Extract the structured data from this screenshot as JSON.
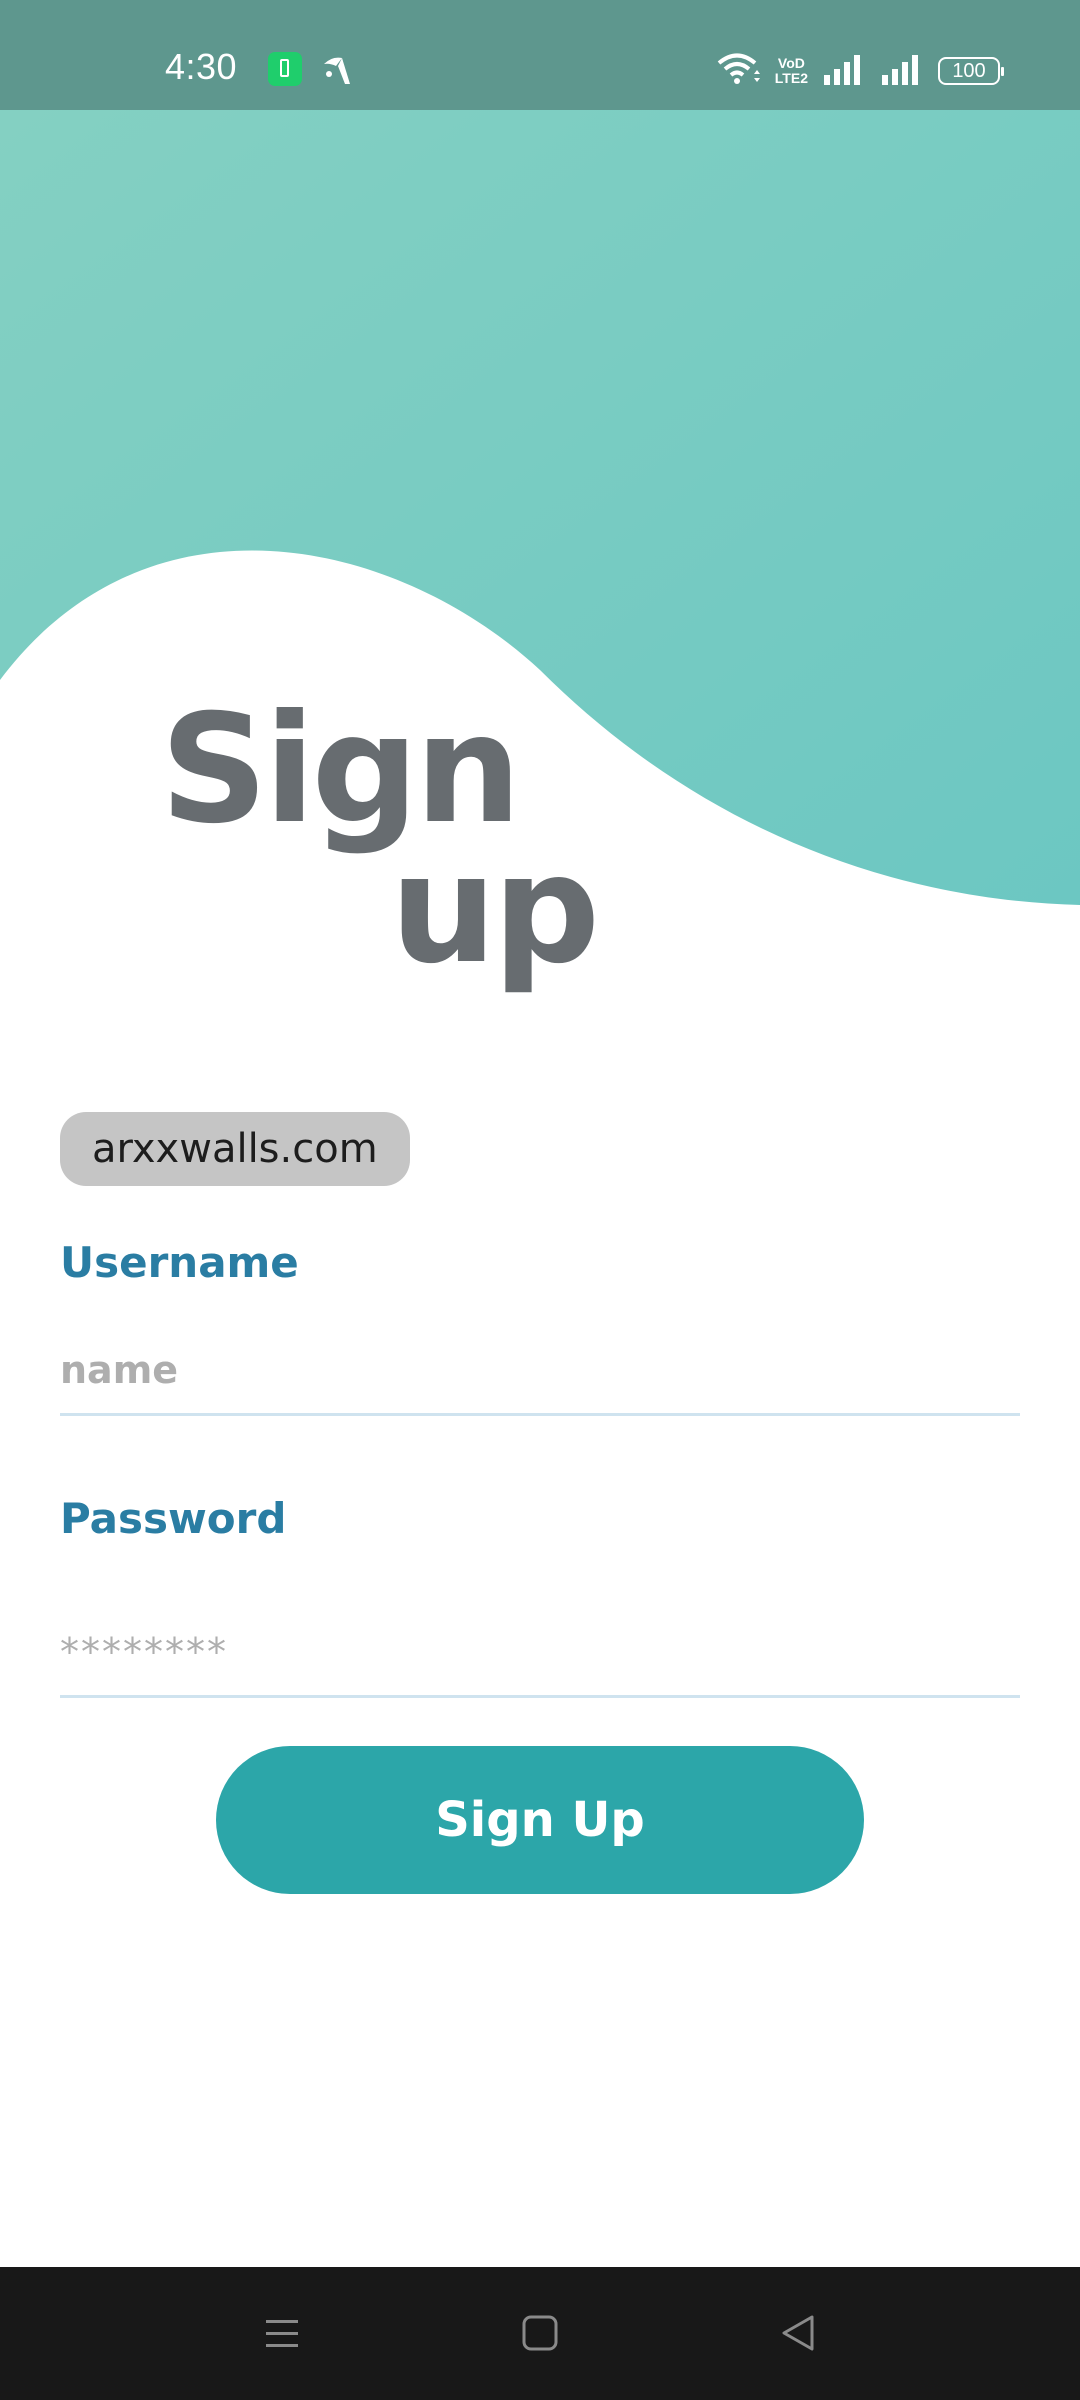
{
  "status_bar": {
    "time": "4:30",
    "battery_level": "100",
    "volte_top": "VoD",
    "volte_bottom": "LTE2"
  },
  "title": {
    "line1": "Sign",
    "line2": "up"
  },
  "site_chip": "arxxwalls.com",
  "form": {
    "username_label": "Username",
    "username_placeholder": "name",
    "password_label": "Password",
    "password_placeholder": "********",
    "submit_label": "Sign Up"
  },
  "colors": {
    "accent": "#2ca6a9",
    "label": "#2a7da3",
    "title": "#676c70",
    "wave_start": "#84d0c2",
    "wave_end": "#6cc7c2"
  },
  "icons": {
    "status": [
      "battery-saver-icon",
      "carrier-icon",
      "wifi-icon",
      "volte-icon",
      "signal-icon",
      "battery-icon"
    ],
    "nav": [
      "menu-icon",
      "home-icon",
      "back-icon"
    ]
  }
}
